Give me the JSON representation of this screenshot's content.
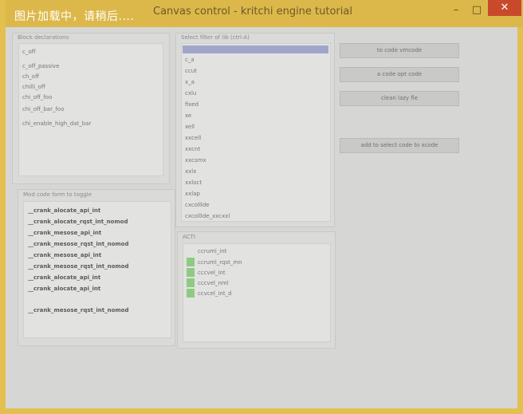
{
  "window": {
    "title": "Canvas control - kritchi engine tutorial",
    "loading_text": "图片加载中，请稍后....",
    "controls": {
      "minimize": "–",
      "maximize": "□",
      "close": "✕"
    }
  },
  "colors": {
    "title_bar": "#dcb84a",
    "window_bg": "#d6d6d4",
    "selection": "#9fa6c9",
    "check": "#8fca84",
    "close": "#c94a2a"
  },
  "panel_top_left": {
    "label": "Block declarations",
    "items": [
      "c_off",
      "c_off_passive",
      "ch_off",
      "chilli_off",
      "chi_off_foo",
      "chi_off_bar_foo",
      "chi_enable_high_dat_bar"
    ]
  },
  "panel_bottom_left": {
    "label": "Mod code form to toggle",
    "items": [
      "__crank_alocate_api_int",
      "__crank_alocate_rqst_int_nomod",
      "__crank_mesose_api_int",
      "__crank_mesose_rqst_int_nomod",
      "__crank_mesose_api_int",
      "__crank_mesose_rqst_int_nomod",
      "__crank_alocate_api_int",
      "__crank_alocate_api_int",
      "__crank_mesose_rqst_int_nomod"
    ]
  },
  "panel_top_middle": {
    "label": "Select filter of lib (ctrl-A)",
    "selected_index": 0,
    "items": [
      "",
      "c_a",
      "ccut",
      "x_a",
      "cxlu",
      "fixed",
      "xe",
      "xell",
      "xxcell",
      "xxcnt",
      "xxcsmx",
      "xxlx",
      "xxloct",
      "xxlap",
      "cxcolllde",
      "cxcolllde_xxcxxl"
    ]
  },
  "panel_bottom_middle": {
    "label": "ACTI",
    "items": [
      "ccruml_int",
      "ccruml_rqst_mn",
      "cccvel_int",
      "cccvel_nml",
      "ccvcel_int_d"
    ]
  },
  "buttons": {
    "b1": "to code vmcode",
    "b2": "a code opt code",
    "b3": "clean lazy fle",
    "b4": "add to select code to xcode"
  }
}
